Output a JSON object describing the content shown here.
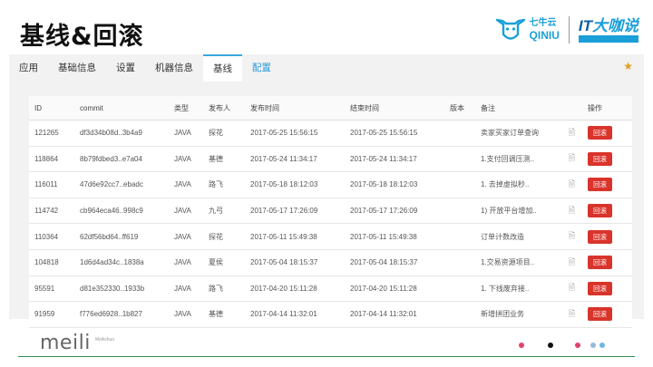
{
  "slide": {
    "title": "基线&回滚"
  },
  "logos": {
    "qiniu_cn": "七牛云",
    "qiniu_en": "QINIU",
    "itdk_it": "IT",
    "itdk_cn": "大咖说"
  },
  "tabs": [
    {
      "label": "应用"
    },
    {
      "label": "基础信息"
    },
    {
      "label": "设置"
    },
    {
      "label": "机器信息"
    },
    {
      "label": "基线"
    },
    {
      "label": "配置"
    }
  ],
  "table": {
    "headers": [
      "ID",
      "commit",
      "类型",
      "发布人",
      "发布时间",
      "结束时间",
      "版本",
      "备注",
      "操作"
    ],
    "rows": [
      {
        "id": "121265",
        "commit": "df3d34b08d..3b4a9",
        "type": "JAVA",
        "publisher": "探花",
        "start": "2017-05-25 15:56:15",
        "end": "2017-05-25 15:56:15",
        "version": "",
        "note": "卖家买家订单查询",
        "action": "回滚"
      },
      {
        "id": "118864",
        "commit": "8b79fdbed3..e7a04",
        "type": "JAVA",
        "publisher": "基德",
        "start": "2017-05-24 11:34:17",
        "end": "2017-05-24 11:34:17",
        "version": "",
        "note": "1.支付回调压测..",
        "action": "回滚"
      },
      {
        "id": "116011",
        "commit": "47d6e92cc7..ebadc",
        "type": "JAVA",
        "publisher": "路飞",
        "start": "2017-05-18 18:12:03",
        "end": "2017-05-18 18:12:03",
        "version": "",
        "note": "1. 去掉虚拟秒..",
        "action": "回滚"
      },
      {
        "id": "114742",
        "commit": "cb964eca46..998c9",
        "type": "JAVA",
        "publisher": "九弓",
        "start": "2017-05-17 17:26:09",
        "end": "2017-05-17 17:26:09",
        "version": "",
        "note": "1) 开放平台增加..",
        "action": "回滚"
      },
      {
        "id": "110364",
        "commit": "62df56bd64..ff619",
        "type": "JAVA",
        "publisher": "探花",
        "start": "2017-05-11 15:49:38",
        "end": "2017-05-11 15:49:38",
        "version": "",
        "note": "订单计数改造",
        "action": "回滚"
      },
      {
        "id": "104818",
        "commit": "1d6d4ad34c..1838a",
        "type": "JAVA",
        "publisher": "夏侯",
        "start": "2017-05-04 18:15:37",
        "end": "2017-05-04 18:15:37",
        "version": "",
        "note": "1.交易资源项目..",
        "action": "回滚"
      },
      {
        "id": "95591",
        "commit": "d81e352330..1933b",
        "type": "JAVA",
        "publisher": "路飞",
        "start": "2017-04-20 15:11:28",
        "end": "2017-04-20 15:11:28",
        "version": "",
        "note": "1. 下线废弃接..",
        "action": "回滚"
      },
      {
        "id": "91959",
        "commit": "f776ed6928..1b827",
        "type": "JAVA",
        "publisher": "基德",
        "start": "2017-04-14 11:32:01",
        "end": "2017-04-14 11:32:01",
        "version": "",
        "note": "新增拼团业务",
        "action": "回滚"
      }
    ]
  },
  "footer": {
    "brand": "meili",
    "brand_sub": "Meilishuo"
  },
  "colors": {
    "accent": "#3aa7dd",
    "danger": "#d9342b",
    "footer_line": "#2f8f4f"
  },
  "icons": {
    "star": "star-icon",
    "note_doc": "document-icon"
  }
}
